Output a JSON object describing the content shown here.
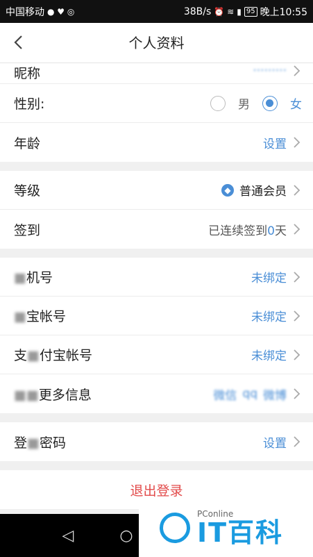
{
  "status_bar": {
    "carrier": "中国移动",
    "speed": "38B/s",
    "battery": "95",
    "time": "晚上10:55"
  },
  "header": {
    "title": "个人资料"
  },
  "profile": {
    "nickname_label": "昵称",
    "nickname_value": "·········",
    "gender_label": "性别:",
    "gender_male": "男",
    "gender_female": "女",
    "gender_selected": "女",
    "age_label": "年龄",
    "age_value": "设置"
  },
  "level": {
    "level_label": "等级",
    "level_value": "普通会员",
    "checkin_label": "签到",
    "checkin_prefix": "已连续签到",
    "checkin_days": "0",
    "checkin_suffix": "天"
  },
  "accounts": {
    "phone_label": "机号",
    "phone_value": "未绑定",
    "taobao_label": "宝帐号",
    "taobao_value": "未绑定",
    "alipay_label_a": "支",
    "alipay_label_b": "付宝帐号",
    "alipay_value": "未绑定",
    "more_label": "更多信息",
    "more_values": [
      "微信",
      "qq",
      "微博"
    ]
  },
  "security": {
    "password_label_a": "登",
    "password_label_b": "密码",
    "password_value": "设置"
  },
  "logout_label": "退出登录",
  "watermark": {
    "small": "PConline",
    "big": "IT百科"
  },
  "colors": {
    "accent": "#4a8ed6",
    "logout": "#e24a4a",
    "background": "#f0f0f0"
  }
}
